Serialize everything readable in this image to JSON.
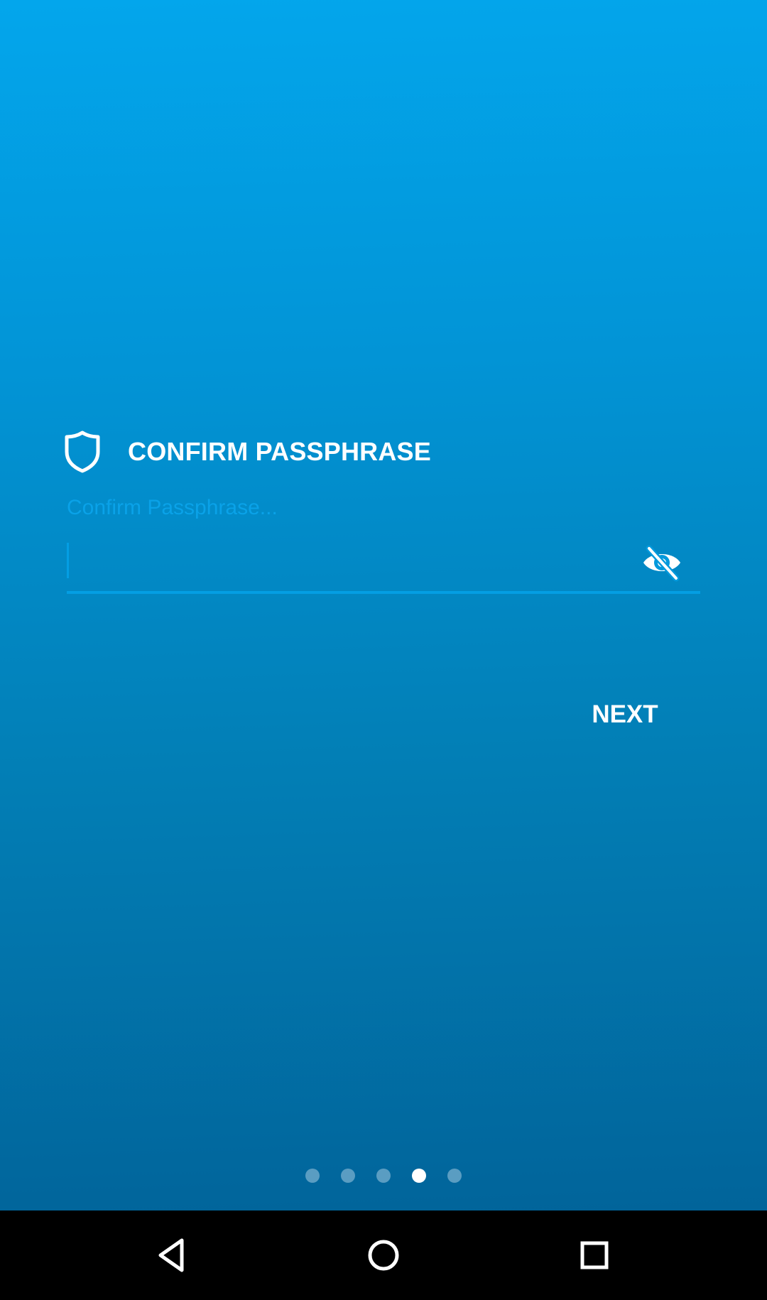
{
  "header": {
    "icon": "shield-icon",
    "title": "CONFIRM PASSPHRASE"
  },
  "passphrase_field": {
    "label": "Confirm Passphrase...",
    "value": "",
    "visibility_icon": "eye-off-icon"
  },
  "actions": {
    "next_label": "NEXT"
  },
  "pager": {
    "total": 5,
    "current": 4
  },
  "navbar": {
    "back_icon": "back-triangle-icon",
    "home_icon": "home-circle-icon",
    "recents_icon": "recents-square-icon"
  },
  "colors": {
    "background_top": "#03a6ec",
    "background_bottom": "#01649a",
    "accent": "#049ee3",
    "text": "#ffffff"
  }
}
